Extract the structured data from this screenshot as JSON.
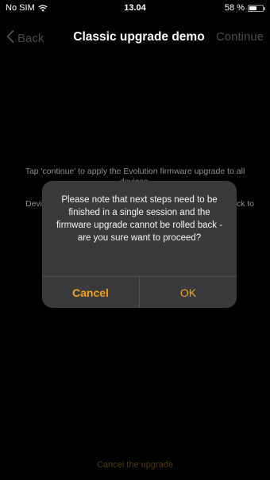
{
  "status_bar": {
    "carrier": "No SIM",
    "time": "13.04",
    "battery_percent": "58 %",
    "battery_level": 0.58
  },
  "nav": {
    "back_label": "Back",
    "title": "Classic upgrade demo",
    "continue_label": "Continue"
  },
  "body": {
    "info_text": "Tap 'continue' to apply the Evolution firmware upgrade to all devices.",
    "devices_left": "Devi",
    "devices_right": "ck to"
  },
  "alert": {
    "message": "Please note that next steps need to be finished in a single session and the firmware upgrade cannot be rolled back - are you sure want to proceed?",
    "cancel_label": "Cancel",
    "ok_label": "OK"
  },
  "footer": {
    "cancel_upgrade_label": "Cancel the upgrade"
  },
  "colors": {
    "accent": "#f4a11d",
    "background": "#000000",
    "alert_background": "#3a3a3c"
  }
}
